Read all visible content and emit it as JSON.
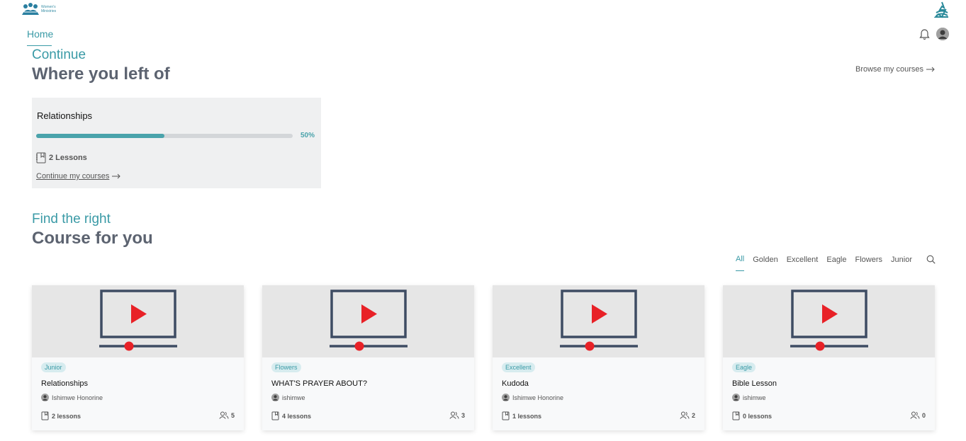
{
  "brand": {
    "logo_text": "Women's Ministries"
  },
  "nav": {
    "home_label": "Home"
  },
  "continue_section": {
    "subtitle": "Continue",
    "title": "Where you left of",
    "browse_label": "Browse my courses",
    "resume": {
      "course_title": "Relationships",
      "progress": 0.5,
      "progress_label": "50%",
      "lessons_label": "2 Lessons",
      "link_label": "Continue my courses"
    }
  },
  "find_section": {
    "subtitle": "Find the right",
    "title": "Course for you",
    "filters": [
      "All",
      "Golden",
      "Excellent",
      "Eagle",
      "Flowers",
      "Junior"
    ],
    "active_filter": "All"
  },
  "courses": [
    {
      "badge": "Junior",
      "title": "Relationships",
      "author": "Ishimwe Honorine",
      "lessons": "2 lessons",
      "students": "5"
    },
    {
      "badge": "Flowers",
      "title": "WHAT'S PRAYER ABOUT?",
      "author": "ishimwe",
      "lessons": "4 lessons",
      "students": "3"
    },
    {
      "badge": "Excellent",
      "title": "Kudoda",
      "author": "Ishimwe Honorine",
      "lessons": "1 lessons",
      "students": "2"
    },
    {
      "badge": "Eagle",
      "title": "Bible Lesson",
      "author": "ishimwe",
      "lessons": "0 lessons",
      "students": "0"
    }
  ],
  "colors": {
    "accent": "#3a9aa6",
    "progress": "#4aa3ab",
    "play_red": "#e82127",
    "screen_navy": "#3e4c63"
  },
  "icons": [
    "logo-icon",
    "church-logo-icon",
    "bell-icon",
    "avatar-icon",
    "arrow-right-icon",
    "book-icon",
    "search-icon",
    "users-icon",
    "video-play-icon"
  ]
}
